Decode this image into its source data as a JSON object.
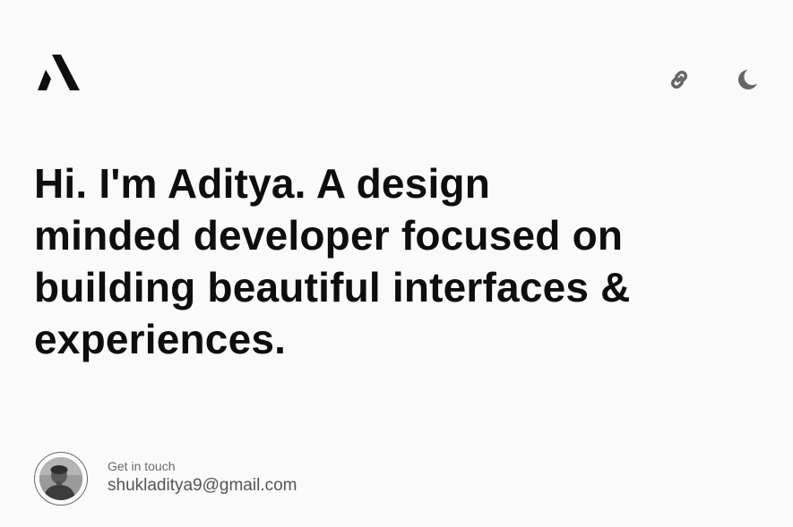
{
  "header": {
    "logo_icon": "stylized-a-logo",
    "actions": [
      {
        "icon": "link-icon"
      },
      {
        "icon": "moon-icon"
      }
    ]
  },
  "hero": {
    "headline": "Hi. I'm Aditya. A design minded developer focused on building beautiful interfaces & experiences."
  },
  "contact": {
    "avatar_icon": "avatar",
    "label": "Get in touch",
    "email": "shukladitya9@gmail.com"
  },
  "colors": {
    "background": "#fafafa",
    "text": "#0e0e0e",
    "icon": "#666666",
    "muted": "#6b6b6b"
  }
}
